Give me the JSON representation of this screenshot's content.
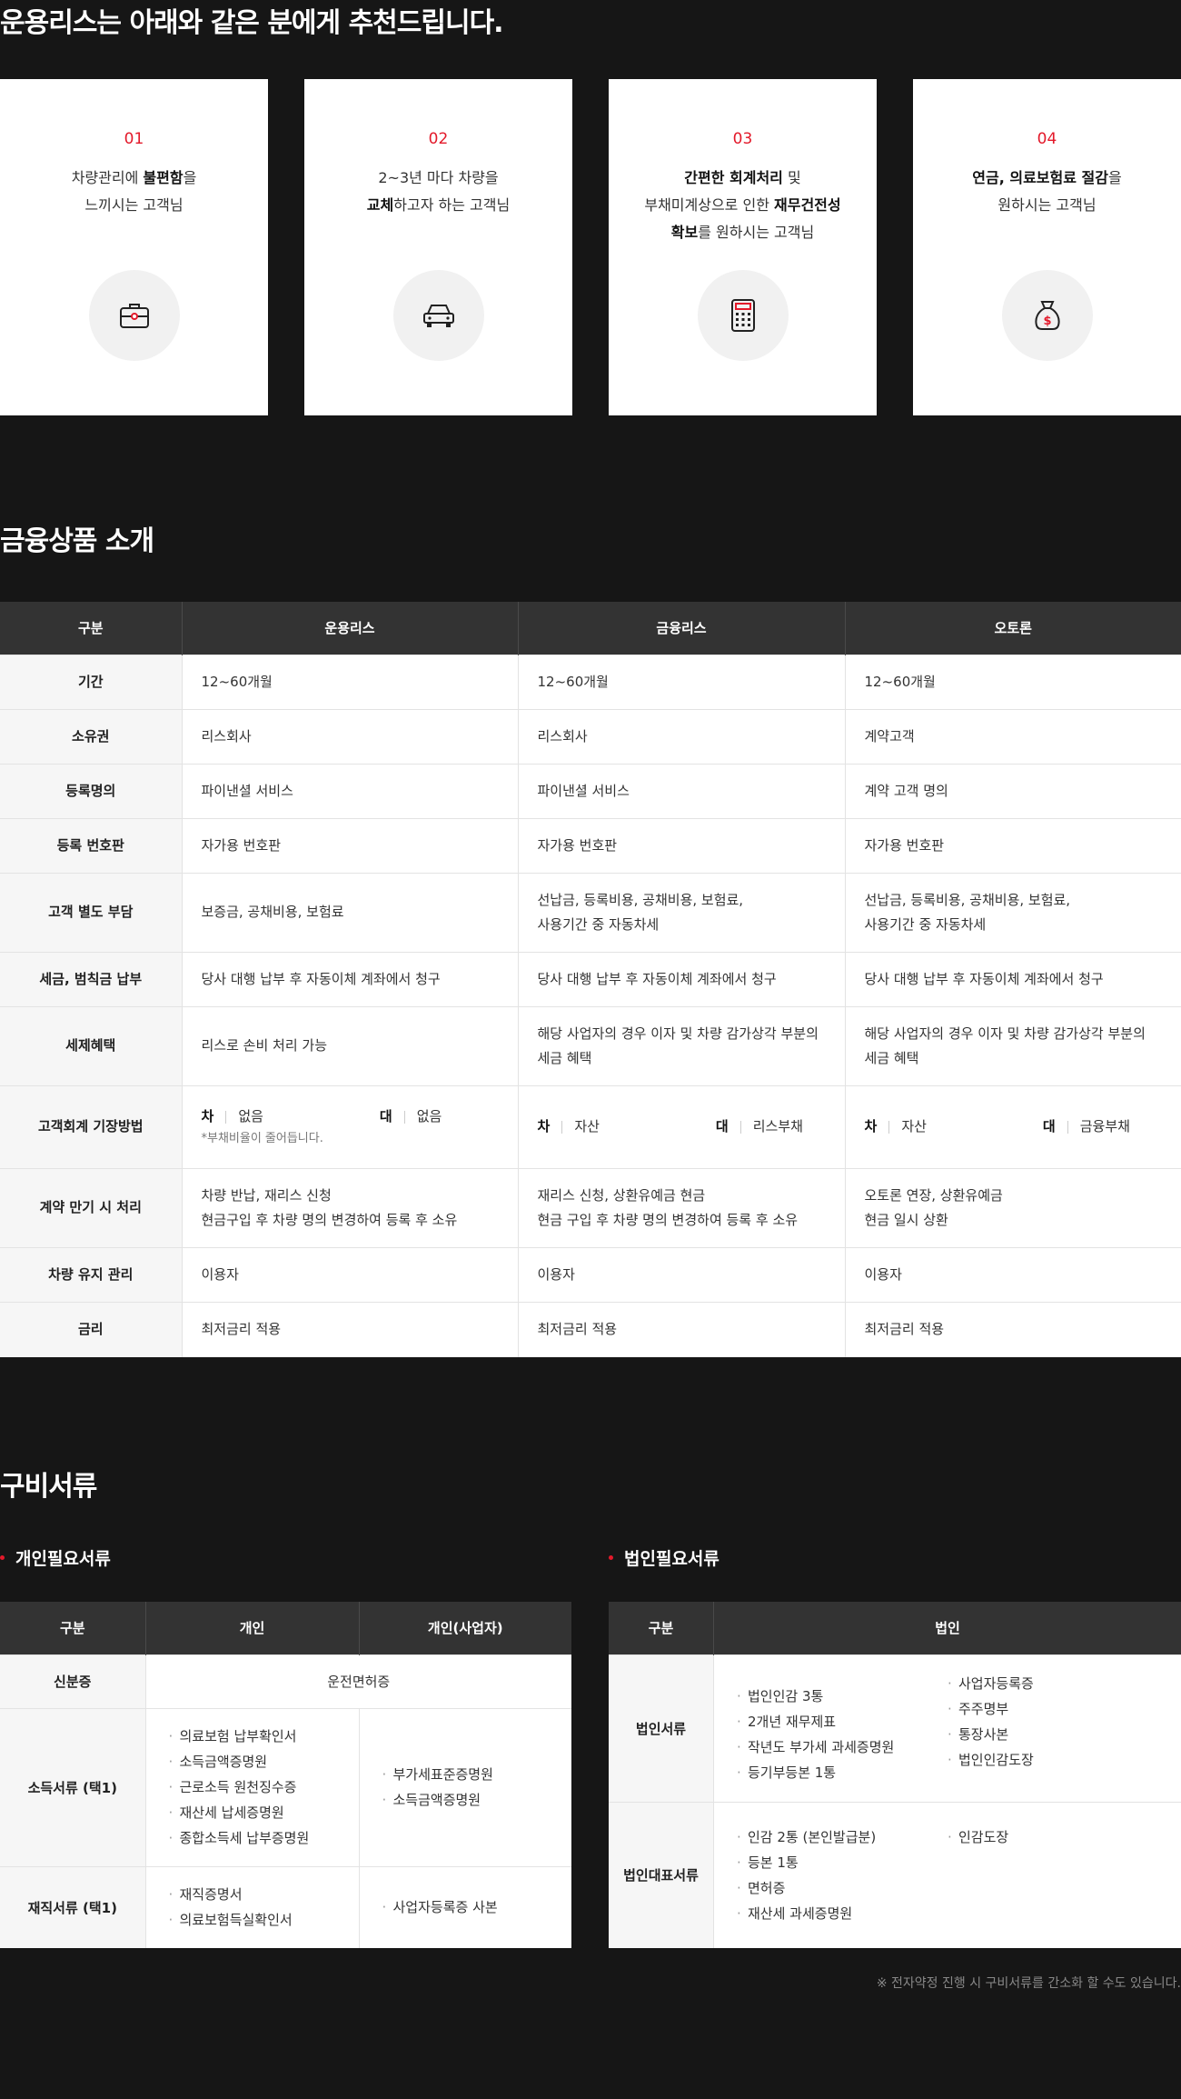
{
  "recommend": {
    "title": "운용리스는 아래와 같은 분에게 추천드립니다.",
    "cards": [
      {
        "num": "01",
        "lines": [
          [
            "차량관리에 ",
            ""
          ],
          [
            "불편함",
            "b"
          ],
          [
            "을",
            ""
          ]
        ],
        "line2": "느끼시는 고객님",
        "icon": "briefcase-icon"
      },
      {
        "num": "02",
        "line1": "2~3년 마다 차량을",
        "line2a": "교체",
        "line2b": "하고자 하는 고객님",
        "icon": "car-icon"
      },
      {
        "num": "03",
        "line1a": "간편한 회계처리",
        "line1b": " 및",
        "line2a": "부채미계상으로 인한 ",
        "line2b": "재무건전성",
        "line3a": "확보",
        "line3b": "를 원하시는 고객님",
        "icon": "calculator-icon"
      },
      {
        "num": "04",
        "line1a": "연금, 의료보험료 절감",
        "line1b": "을",
        "line2": "원하시는 고객님",
        "icon": "money-bag-icon"
      }
    ],
    "card1": {
      "a": "차량관리에 ",
      "b": "불편함",
      "c": "을",
      "line2": "느끼시는 고객님"
    }
  },
  "products": {
    "title": "금융상품 소개",
    "headers": [
      "구분",
      "운용리스",
      "금융리스",
      "오토론"
    ],
    "rows": [
      {
        "label": "기간",
        "c": [
          "12~60개월",
          "12~60개월",
          "12~60개월"
        ]
      },
      {
        "label": "소유권",
        "c": [
          "리스회사",
          "리스회사",
          "계약고객"
        ]
      },
      {
        "label": "등록명의",
        "c": [
          "파이낸셜 서비스",
          "파이낸셜 서비스",
          "계약 고객 명의"
        ]
      },
      {
        "label": "등록 번호판",
        "c": [
          "자가용 번호판",
          "자가용 번호판",
          "자가용 번호판"
        ]
      },
      {
        "label": "고객 별도 부담",
        "c": [
          "보증금, 공채비용, 보험료",
          "선납금, 등록비용, 공채비용, 보험료,",
          "선납금, 등록비용, 공채비용, 보험료,"
        ],
        "c2": [
          "",
          "사용기간 중 자동차세",
          "사용기간 중 자동차세"
        ]
      },
      {
        "label": "세금, 범칙금 납부",
        "c": [
          "당사 대행 납부 후 자동이체 계좌에서 청구",
          "당사 대행 납부 후 자동이체 계좌에서 청구",
          "당사 대행 납부 후 자동이체 계좌에서 청구"
        ]
      },
      {
        "label": "세제혜택",
        "c": [
          "리스로 손비 처리 가능",
          "해당 사업자의 경우 이자 및 차량 감가상각 부분의",
          "해당 사업자의 경우 이자 및 차량 감가상각 부분의"
        ],
        "c2": [
          "",
          "세금 혜택",
          "세금 혜택"
        ]
      },
      {
        "label": "고객회계 기장방법",
        "acct": [
          {
            "dl": "차",
            "dv": "없음",
            "cl": "대",
            "cv": "없음",
            "note": "*부채비율이 줄어듭니다."
          },
          {
            "dl": "차",
            "dv": "자산",
            "cl": "대",
            "cv": "리스부채"
          },
          {
            "dl": "차",
            "dv": "자산",
            "cl": "대",
            "cv": "금융부채"
          }
        ]
      },
      {
        "label": "계약 만기 시 처리",
        "c": [
          "차량 반납, 재리스 신청",
          "재리스 신청, 상환유예금 현금",
          "오토론 연장, 상환유예금"
        ],
        "c2": [
          "현금구입 후 차량 명의 변경하여 등록 후 소유",
          "현금 구입 후 차량 명의 변경하여 등록 후 소유",
          "현금 일시 상환"
        ]
      },
      {
        "label": "차량 유지 관리",
        "c": [
          "이용자",
          "이용자",
          "이용자"
        ]
      },
      {
        "label": "금리",
        "c": [
          "최저금리 적용",
          "최저금리 적용",
          "최저금리 적용"
        ]
      }
    ]
  },
  "docs": {
    "title": "구비서류",
    "personal": {
      "title": "개인필요서류",
      "headers": [
        "구분",
        "개인",
        "개인(사업자)"
      ],
      "id_label": "신분증",
      "id_value": "운전면허증",
      "income_label": "소득서류 (택1)",
      "income_personal": [
        "의료보험 납부확인서",
        "소득금액증명원",
        "근로소득 원천징수증",
        "재산세 납세증명원",
        "종합소득세 납부증명원"
      ],
      "income_business": [
        "부가세표준증명원",
        "소득금액증명원"
      ],
      "employ_label": "재직서류 (택1)",
      "employ_personal": [
        "재직증명서",
        "의료보험득실확인서"
      ],
      "employ_business": [
        "사업자등록증 사본"
      ]
    },
    "corporate": {
      "title": "법인필요서류",
      "headers": [
        "구분",
        "법인"
      ],
      "corp_label": "법인서류",
      "corp_col1": [
        "법인인감 3통",
        "2개년 재무제표",
        "작년도 부가세 과세증명원",
        "등기부등본 1통"
      ],
      "corp_col2": [
        "사업자등록증",
        "주주명부",
        "통장사본",
        "법인인감도장"
      ],
      "rep_label": "법인대표서류",
      "rep_col1": [
        "인감 2통 (본인발급분)",
        "등본 1통",
        "면허증",
        "재산세 과세증명원"
      ],
      "rep_col2": [
        "인감도장"
      ]
    },
    "footnote": "※ 전자약정 진행 시 구비서류를 간소화 할 수도 있습니다."
  },
  "colors": {
    "accent": "#e3192a",
    "bg": "#161616",
    "header": "#333333"
  }
}
